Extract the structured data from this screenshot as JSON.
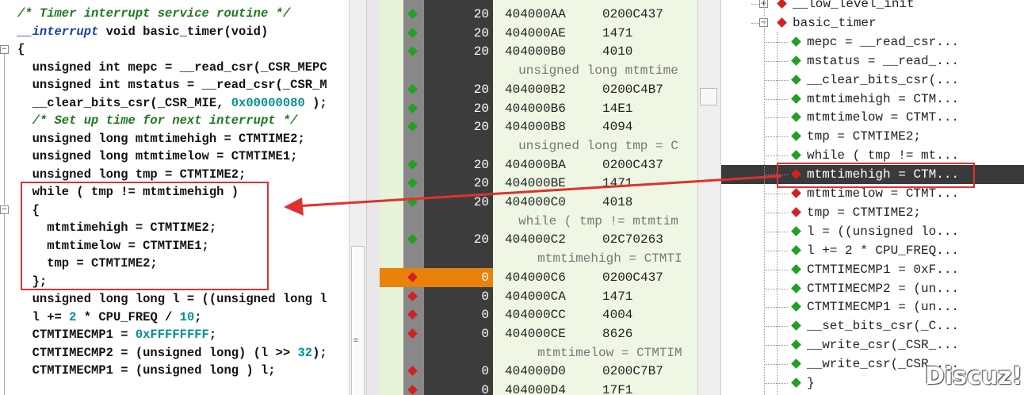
{
  "code_lines": [
    {
      "segments": [
        {
          "t": "/* Timer interrupt service routine */",
          "c": "cmt"
        }
      ]
    },
    {
      "segments": [
        {
          "t": "__interrupt",
          "c": "it"
        },
        {
          "t": " void basic_timer(void)",
          "c": ""
        }
      ]
    },
    {
      "segments": [
        {
          "t": "{",
          "c": ""
        }
      ]
    },
    {
      "segments": [
        {
          "t": "  unsigned int mepc = __read_csr(_CSR_MEPC",
          "c": ""
        }
      ]
    },
    {
      "segments": [
        {
          "t": "  unsigned int mstatus = __read_csr(_CSR_M",
          "c": ""
        }
      ]
    },
    {
      "segments": [
        {
          "t": "  __clear_bits_csr(_CSR_MIE, ",
          "c": ""
        },
        {
          "t": "0x00000080",
          "c": "num"
        },
        {
          "t": " );",
          "c": ""
        }
      ]
    },
    {
      "segments": [
        {
          "t": "  /* Set up time for next interrupt */",
          "c": "cmt"
        }
      ]
    },
    {
      "segments": [
        {
          "t": "  unsigned long mtmtimehigh = CTMTIME2;",
          "c": ""
        }
      ]
    },
    {
      "segments": [
        {
          "t": "  unsigned long mtmtimelow = CTMTIME1;",
          "c": ""
        }
      ]
    },
    {
      "segments": [
        {
          "t": "  unsigned long tmp = CTMTIME2;",
          "c": ""
        }
      ]
    },
    {
      "segments": [
        {
          "t": "  while ( tmp != mtmtimehigh )",
          "c": ""
        }
      ]
    },
    {
      "segments": [
        {
          "t": "  {",
          "c": ""
        }
      ]
    },
    {
      "segments": [
        {
          "t": "    mtmtimehigh = CTMTIME2;",
          "c": ""
        }
      ]
    },
    {
      "segments": [
        {
          "t": "    mtmtimelow = CTMTIME1;",
          "c": ""
        }
      ]
    },
    {
      "segments": [
        {
          "t": "    tmp = CTMTIME2;",
          "c": ""
        }
      ]
    },
    {
      "segments": [
        {
          "t": "  };",
          "c": ""
        }
      ]
    },
    {
      "segments": [
        {
          "t": "  unsigned long long l = ((unsigned long l",
          "c": ""
        }
      ]
    },
    {
      "segments": [
        {
          "t": "  l += ",
          "c": ""
        },
        {
          "t": "2",
          "c": "num"
        },
        {
          "t": " * CPU_FREQ / ",
          "c": ""
        },
        {
          "t": "10",
          "c": "num"
        },
        {
          "t": ";",
          "c": ""
        }
      ]
    },
    {
      "segments": [
        {
          "t": "  CTMTIMECMP1 = ",
          "c": ""
        },
        {
          "t": "0xFFFFFFFF",
          "c": "num"
        },
        {
          "t": ";",
          "c": ""
        }
      ]
    },
    {
      "segments": [
        {
          "t": "  CTMTIMECMP2 = (unsigned long) (l >> ",
          "c": ""
        },
        {
          "t": "32",
          "c": "num"
        },
        {
          "t": ");",
          "c": ""
        }
      ]
    },
    {
      "segments": [
        {
          "t": "  CTMTIMECMP1 = (unsigned long ) l;",
          "c": ""
        }
      ]
    }
  ],
  "disasm_rows": [
    {
      "kind": "ins",
      "marker": "green",
      "count": "20",
      "addr": "404000AA",
      "op": "0200C437"
    },
    {
      "kind": "ins",
      "marker": "green",
      "count": "20",
      "addr": "404000AE",
      "op": "1471"
    },
    {
      "kind": "ins",
      "marker": "green",
      "count": "20",
      "addr": "404000B0",
      "op": "4010"
    },
    {
      "kind": "src",
      "text": "unsigned long mtmtime"
    },
    {
      "kind": "ins",
      "marker": "green",
      "count": "20",
      "addr": "404000B2",
      "op": "0200C4B7"
    },
    {
      "kind": "ins",
      "marker": "green",
      "count": "20",
      "addr": "404000B6",
      "op": "14E1"
    },
    {
      "kind": "ins",
      "marker": "green",
      "count": "20",
      "addr": "404000B8",
      "op": "4094"
    },
    {
      "kind": "src",
      "text": "unsigned long tmp = C"
    },
    {
      "kind": "ins",
      "marker": "green",
      "count": "20",
      "addr": "404000BA",
      "op": "0200C437"
    },
    {
      "kind": "ins",
      "marker": "green",
      "count": "20",
      "addr": "404000BE",
      "op": "1471"
    },
    {
      "kind": "ins",
      "marker": "green",
      "count": "20",
      "addr": "404000C0",
      "op": "4018"
    },
    {
      "kind": "src",
      "text": "while ( tmp != mtmtim"
    },
    {
      "kind": "ins",
      "marker": "green",
      "count": "20",
      "addr": "404000C2",
      "op": "02C70263"
    },
    {
      "kind": "src",
      "text": "   mtmtimehigh = CTMTI"
    },
    {
      "kind": "ins",
      "marker": "red",
      "count": "0",
      "addr": "404000C6",
      "op": "0200C437",
      "highlight": true
    },
    {
      "kind": "ins",
      "marker": "red",
      "count": "0",
      "addr": "404000CA",
      "op": "1471"
    },
    {
      "kind": "ins",
      "marker": "red",
      "count": "0",
      "addr": "404000CC",
      "op": "4004"
    },
    {
      "kind": "ins",
      "marker": "red",
      "count": "0",
      "addr": "404000CE",
      "op": "8626"
    },
    {
      "kind": "src",
      "text": "   mtmtimelow = CTMTIM"
    },
    {
      "kind": "ins",
      "marker": "red",
      "count": "0",
      "addr": "404000D0",
      "op": "0200C7B7"
    },
    {
      "kind": "ins",
      "marker": "red",
      "count": "0",
      "addr": "404000D4",
      "op": "17F1"
    }
  ],
  "tree_rows": [
    {
      "label": "__low_level_init",
      "level": 0,
      "expander": "+",
      "marker": "red"
    },
    {
      "label": "basic_timer",
      "level": 0,
      "expander": "-",
      "marker": "red"
    },
    {
      "label": "mepc = __read_csr...",
      "level": 1,
      "marker": "green"
    },
    {
      "label": "mstatus = __read_...",
      "level": 1,
      "marker": "green"
    },
    {
      "label": "__clear_bits_csr(...",
      "level": 1,
      "marker": "green"
    },
    {
      "label": "mtmtimehigh = CTM...",
      "level": 1,
      "marker": "green"
    },
    {
      "label": "mtmtimelow = CTMT...",
      "level": 1,
      "marker": "green"
    },
    {
      "label": "tmp = CTMTIME2;",
      "level": 1,
      "marker": "green"
    },
    {
      "label": "while ( tmp != mt...",
      "level": 1,
      "marker": "green"
    },
    {
      "label": "mtmtimehigh = CTM...",
      "level": 1,
      "marker": "red",
      "selected": true
    },
    {
      "label": "mtmtimelow = CTMT...",
      "level": 1,
      "marker": "red"
    },
    {
      "label": "tmp = CTMTIME2;",
      "level": 1,
      "marker": "red"
    },
    {
      "label": "l = ((unsigned lo...",
      "level": 1,
      "marker": "green"
    },
    {
      "label": "l += 2 * CPU_FREQ...",
      "level": 1,
      "marker": "green"
    },
    {
      "label": "CTMTIMECMP1 = 0xF...",
      "level": 1,
      "marker": "green"
    },
    {
      "label": "CTMTIMECMP2 = (un...",
      "level": 1,
      "marker": "green"
    },
    {
      "label": "CTMTIMECMP1 = (un...",
      "level": 1,
      "marker": "green"
    },
    {
      "label": "__set_bits_csr(_C...",
      "level": 1,
      "marker": "green"
    },
    {
      "label": "__write_csr(_CSR_...",
      "level": 1,
      "marker": "green"
    },
    {
      "label": "__write_csr(_CSR_...",
      "level": 1,
      "marker": "green"
    },
    {
      "label": "}",
      "level": 1,
      "marker": "green"
    }
  ],
  "watermark": "Discuz!",
  "colors": {
    "green_marker": "#22a022",
    "red_marker": "#d42020",
    "highlight": "#e8820a",
    "annotation": "#e03030"
  }
}
